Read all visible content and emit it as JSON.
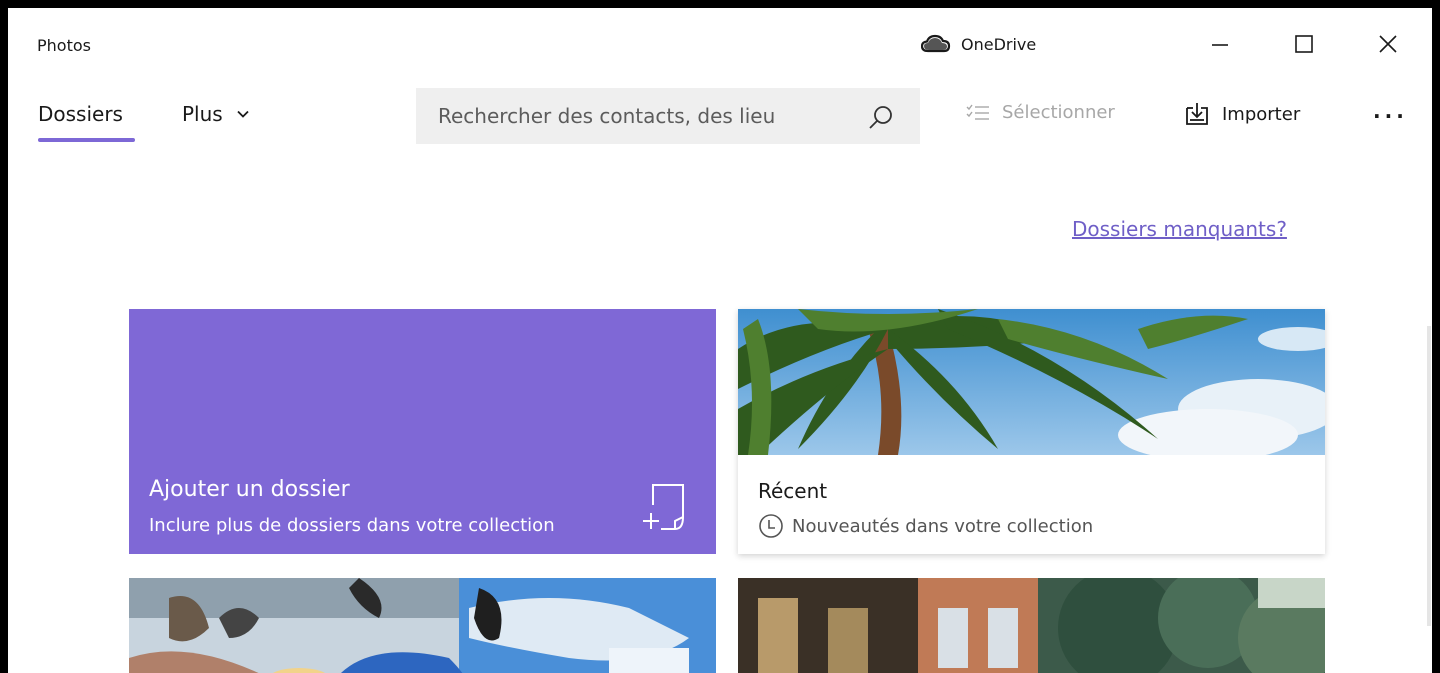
{
  "app": {
    "title": "Photos",
    "onedrive_label": "OneDrive"
  },
  "nav": {
    "tabs": [
      {
        "label": "Dossiers",
        "active": true
      },
      {
        "label": "Plus",
        "has_dropdown": true
      }
    ]
  },
  "search": {
    "placeholder": "Rechercher des contacts, des lieu"
  },
  "toolbar": {
    "select_label": "Sélectionner",
    "import_label": "Importer",
    "more_label": "···"
  },
  "links": {
    "missing_folders": "Dossiers manquants?"
  },
  "tiles": [
    {
      "title": "Ajouter un dossier",
      "subtitle": "Inclure plus de dossiers dans votre collection",
      "icon": "add-folder-icon"
    },
    {
      "title": "Récent",
      "subtitle": "Nouveautés dans votre collection",
      "icon": "clock-icon"
    }
  ],
  "colors": {
    "accent": "#7f68d6",
    "link": "#6f5fc7",
    "search_bg": "#efefef",
    "disabled_text": "#a7a7a7"
  }
}
